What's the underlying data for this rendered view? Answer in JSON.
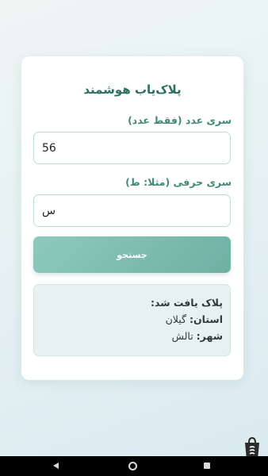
{
  "app": {
    "title": "پلاک‌یاب هوشمند"
  },
  "form": {
    "number_label": "سری عدد (فقط عدد)",
    "number_value": "56",
    "letter_label": "سری حرفی (مثلا: ط)",
    "letter_value": "س",
    "search_label": "جستجو"
  },
  "result": {
    "title": "پلاک یافت شد:",
    "province_label": "استان:",
    "province_value": "گیلان",
    "city_label": "شهر:",
    "city_value": "تالش"
  },
  "icons": {
    "back": "back-triangle-icon",
    "home": "home-circle-icon",
    "recents": "recents-square-icon",
    "watermark": "store-logo-icon"
  },
  "colors": {
    "accent": "#3f8a78",
    "title": "#2c6f5e",
    "button": "#7dbcaf",
    "result_bg": "#e7f1ef",
    "field_border": "#b9ddd3"
  }
}
